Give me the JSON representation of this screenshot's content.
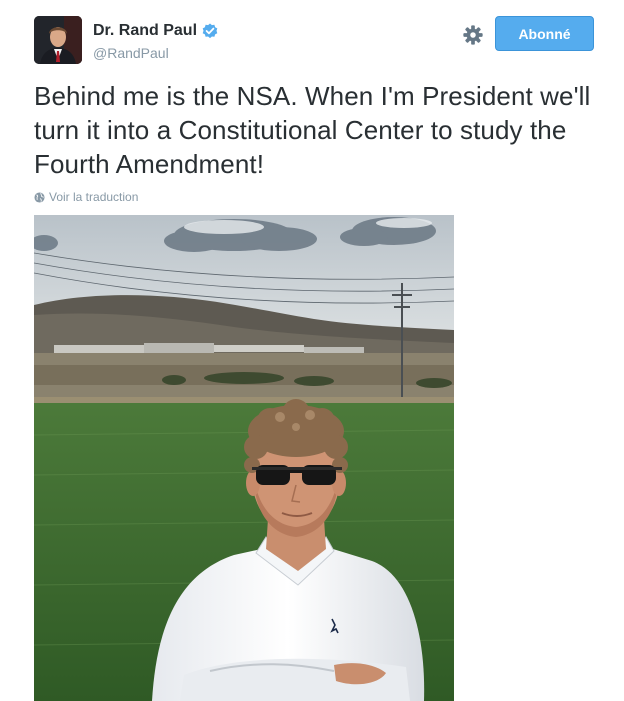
{
  "author": {
    "display_name": "Dr. Rand Paul",
    "handle": "@RandPaul",
    "verified": true,
    "avatar_icon": "profile-photo"
  },
  "actions": {
    "settings_icon": "gear-icon",
    "follow_label": "Abonné"
  },
  "tweet": {
    "text": "Behind me is the NSA. When I'm President we'll turn it into a Constitutional Center to study the Fourth Amendment!",
    "translate_label": "Voir la traduction",
    "translate_icon": "globe-icon"
  },
  "colors": {
    "follow_button": "#55acee",
    "text": "#292f33",
    "muted": "#8899a6",
    "verified_badge": "#55acee"
  }
}
